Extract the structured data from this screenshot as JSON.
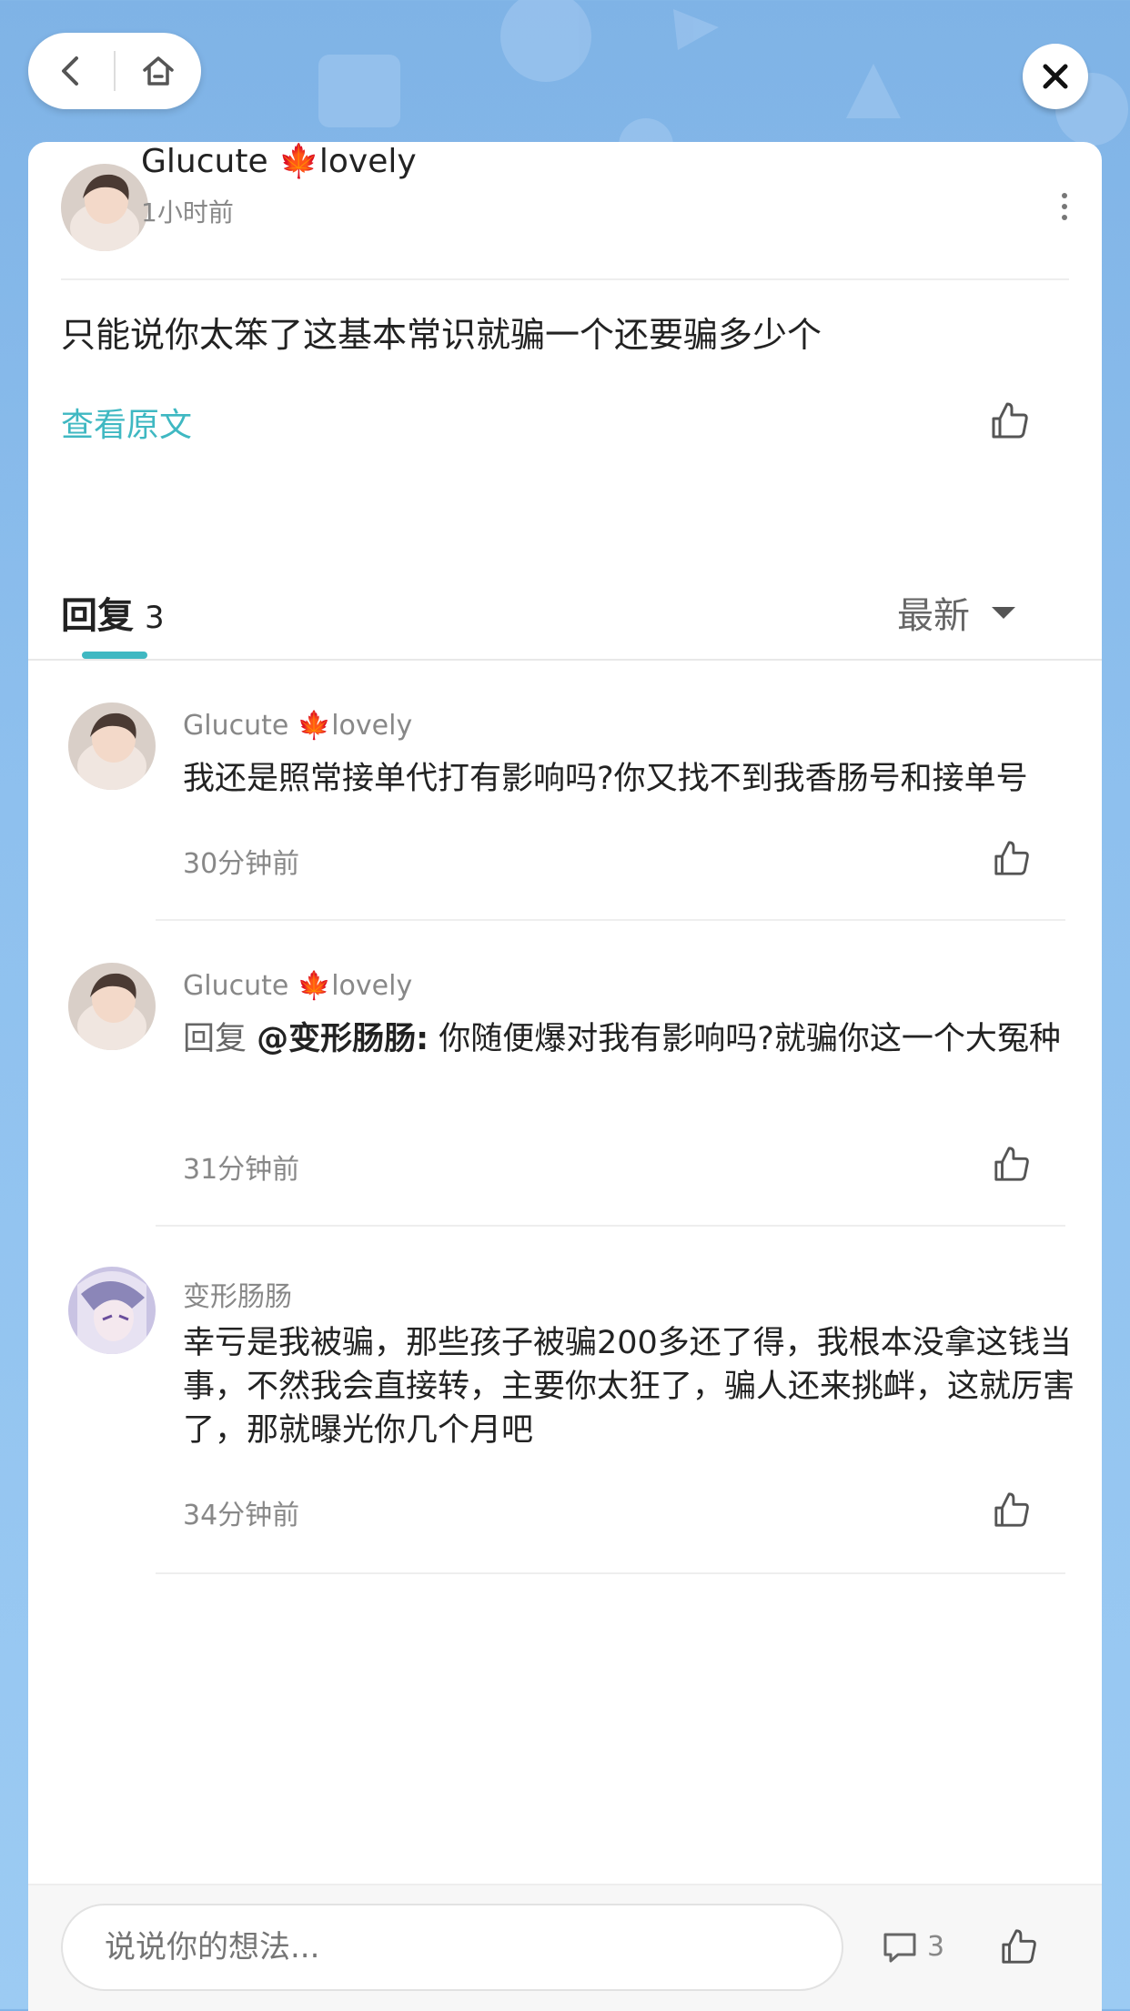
{
  "nav": {
    "back_icon": "chevron-left-icon",
    "home_icon": "home-icon",
    "close_icon": "close-icon"
  },
  "post": {
    "author": "Glucute 🍁lovely",
    "time": "1小时前",
    "body": "只能说你太笨了这基本常识就骗一个还要骗多少个",
    "view_original": "查看原文"
  },
  "replies_section": {
    "title": "回复",
    "count": "3",
    "sort_label": "最新"
  },
  "replies": [
    {
      "name": "Glucute 🍁lovely",
      "reply_prefix": "",
      "mention": "",
      "text": "我还是照常接单代打有影响吗?你又找不到我香肠号和接单号",
      "time": "30分钟前"
    },
    {
      "name": "Glucute 🍁lovely",
      "reply_prefix": "回复 ",
      "mention": "@变形肠肠:",
      "text": " 你随便爆对我有影响吗?就骗你这一个大冤种",
      "time": "31分钟前"
    },
    {
      "name": "变形肠肠",
      "reply_prefix": "",
      "mention": "",
      "text": "幸亏是我被骗，那些孩子被骗200多还了得，我根本没拿这钱当事，不然我会直接转，主要你太狂了，骗人还来挑衅，这就厉害了，那就曝光你几个月吧",
      "time": "34分钟前"
    }
  ],
  "bottom_bar": {
    "input_placeholder": "说说你的想法...",
    "comment_count": "3"
  },
  "colors": {
    "accent": "#3fb8c2",
    "background": "#8ec0ee"
  }
}
